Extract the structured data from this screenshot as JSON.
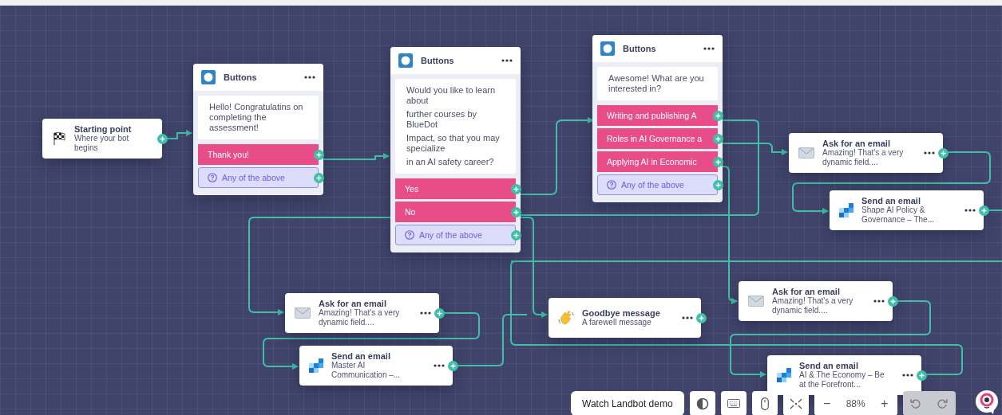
{
  "nodes": [
    {
      "kind": "start",
      "title": "Starting point",
      "subtitle": "Where your bot begins"
    },
    {
      "kind": "buttons",
      "title": "Buttons",
      "message": [
        "Hello! Congratulatins on completing the assessment!"
      ],
      "options": [
        {
          "kind": "reply",
          "label": "Thank you!"
        },
        {
          "kind": "fallback",
          "label": "Any of the above"
        }
      ]
    },
    {
      "kind": "buttons",
      "title": "Buttons",
      "message": [
        "Would you like to learn about",
        "further courses by BlueDot",
        "Impact, so that you may specialize",
        "in an AI safety career?"
      ],
      "options": [
        {
          "kind": "reply",
          "label": "Yes"
        },
        {
          "kind": "reply",
          "label": "No"
        },
        {
          "kind": "fallback",
          "label": "Any of the above"
        }
      ]
    },
    {
      "kind": "buttons",
      "title": "Buttons",
      "message": [
        "Awesome! What are you interested in?"
      ],
      "options": [
        {
          "kind": "reply",
          "label": "Writing and publishing A"
        },
        {
          "kind": "reply",
          "label": "Roles in AI Governance a"
        },
        {
          "kind": "reply",
          "label": "Applying AI in Economic"
        },
        {
          "kind": "fallback",
          "label": "Any of the above"
        }
      ]
    },
    {
      "kind": "ask_email",
      "title": "Ask for an email",
      "subtitle": "Amazing! That's a very dynamic field...."
    },
    {
      "kind": "send_email",
      "title": "Send an email",
      "subtitle": "Shape AI Policy & Governance – The..."
    },
    {
      "kind": "ask_email",
      "title": "Ask for an email",
      "subtitle": "Amazing! That's a very dynamic field...."
    },
    {
      "kind": "goodbye",
      "title": "Goodbye message",
      "subtitle": "A farewell message"
    },
    {
      "kind": "ask_email",
      "title": "Ask for an email",
      "subtitle": "Amazing! That's a very dynamic field...."
    },
    {
      "kind": "send_email",
      "title": "Send an email",
      "subtitle": "Master AI Communication –..."
    },
    {
      "kind": "send_email",
      "title": "Send an email",
      "subtitle": "AI & The Economy – Be at the Forefront..."
    }
  ],
  "toolbar": {
    "demo_button": "Watch Landbot demo",
    "zoom_out": "−",
    "zoom": "88%",
    "zoom_in": "+",
    "history_disabled": true
  }
}
